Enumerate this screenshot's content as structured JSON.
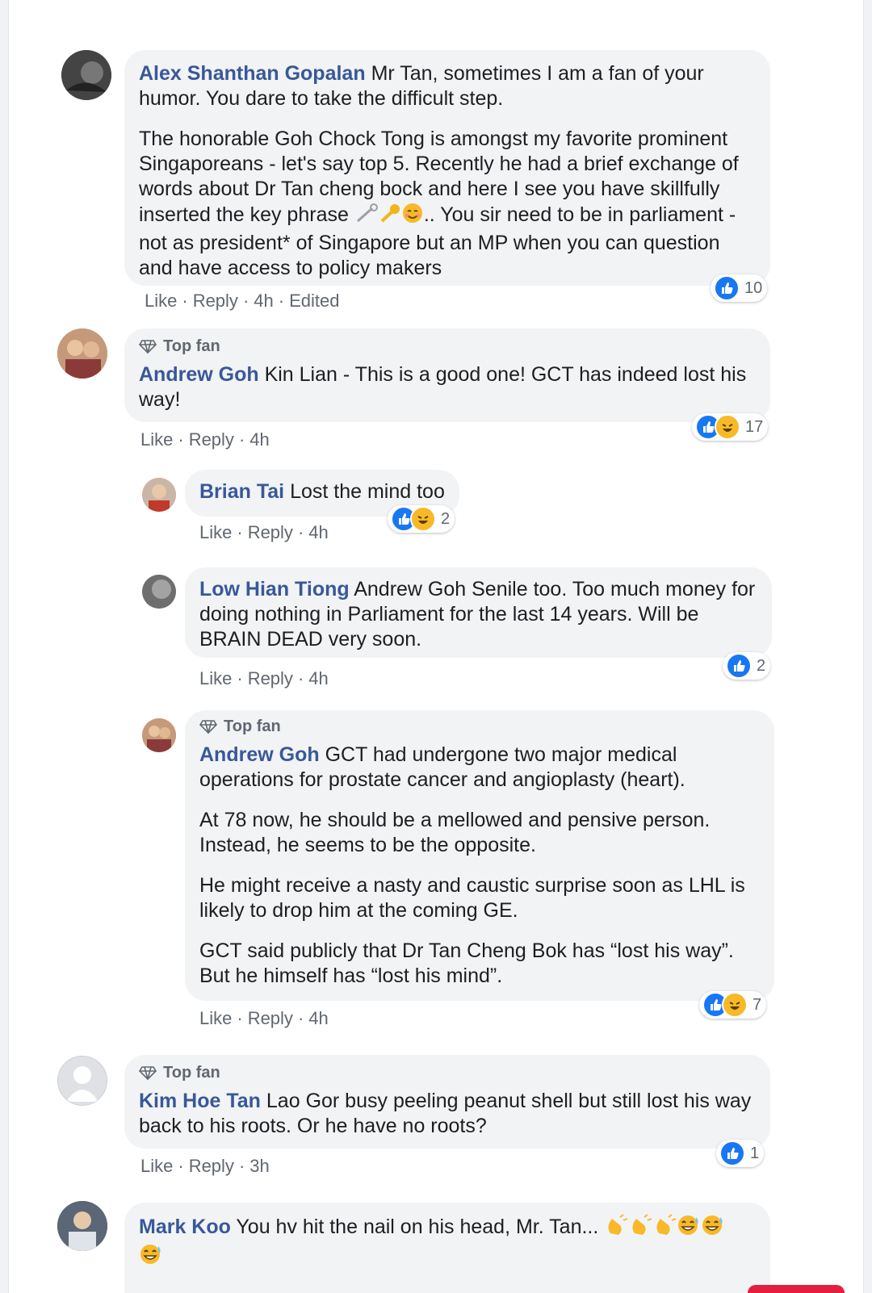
{
  "colors": {
    "name": "#385898",
    "bubble": "#f2f3f5",
    "meta": "#606770",
    "like": "#1877f2",
    "haha": "#f7b928"
  },
  "actions": {
    "like": "Like",
    "reply": "Reply",
    "sep": "·"
  },
  "comments": [
    {
      "author": "Alex Shanthan Gopalan",
      "paragraphs": [
        "Mr Tan, sometimes I am a fan of your humor. You dare to take the difficult step.",
        "The honorable Goh Chock Tong is amongst my favorite prominent Singaporeans - let's say top 5. Recently he had a brief exchange of words about Dr Tan cheng bock and here I see you have skillfully inserted the key phrase",
        ".. You sir need to be in parliament - not as president* of Singapore but an MP when you can question and have access to policy makers"
      ],
      "time": "4h",
      "edited": "Edited",
      "reaction_count": "10",
      "reactions": [
        "like"
      ]
    },
    {
      "top_fan": "Top fan",
      "author": "Andrew Goh",
      "paragraphs": [
        "Kin Lian - This is a good one! GCT has indeed lost his way!"
      ],
      "time": "4h",
      "reaction_count": "17",
      "reactions": [
        "like",
        "haha"
      ]
    },
    {
      "author": "Brian Tai",
      "paragraphs": [
        "Lost the mind too"
      ],
      "time": "4h",
      "reaction_count": "2",
      "reactions": [
        "like",
        "haha"
      ]
    },
    {
      "author": "Low Hian Tiong",
      "paragraphs": [
        "Andrew Goh Senile too. Too much money for doing nothing in Parliament for the last 14 years. Will be BRAIN DEAD very soon."
      ],
      "time": "4h",
      "reaction_count": "2",
      "reactions": [
        "like"
      ]
    },
    {
      "top_fan": "Top fan",
      "author": "Andrew Goh",
      "paragraphs": [
        "GCT had undergone two major medical operations for prostate cancer and angioplasty (heart).",
        "At 78 now, he should be a mellowed and pensive person. Instead, he seems to be the opposite.",
        "He might receive a nasty and caustic surprise soon as LHL is likely to drop him at the coming GE.",
        "GCT said publicly that Dr Tan Cheng Bok has “lost his way”. But he himself has “lost his mind”."
      ],
      "time": "4h",
      "reaction_count": "7",
      "reactions": [
        "like",
        "haha"
      ]
    },
    {
      "top_fan": "Top fan",
      "author": "Kim Hoe Tan",
      "paragraphs": [
        "Lao Gor busy peeling peanut shell but still lost his way back to his roots. Or he have no roots?"
      ],
      "time": "3h",
      "reaction_count": "1",
      "reactions": [
        "like"
      ]
    },
    {
      "author": "Mark Koo",
      "paragraphs": [
        "You hv hit the nail on his head, Mr. Tan..."
      ]
    }
  ]
}
